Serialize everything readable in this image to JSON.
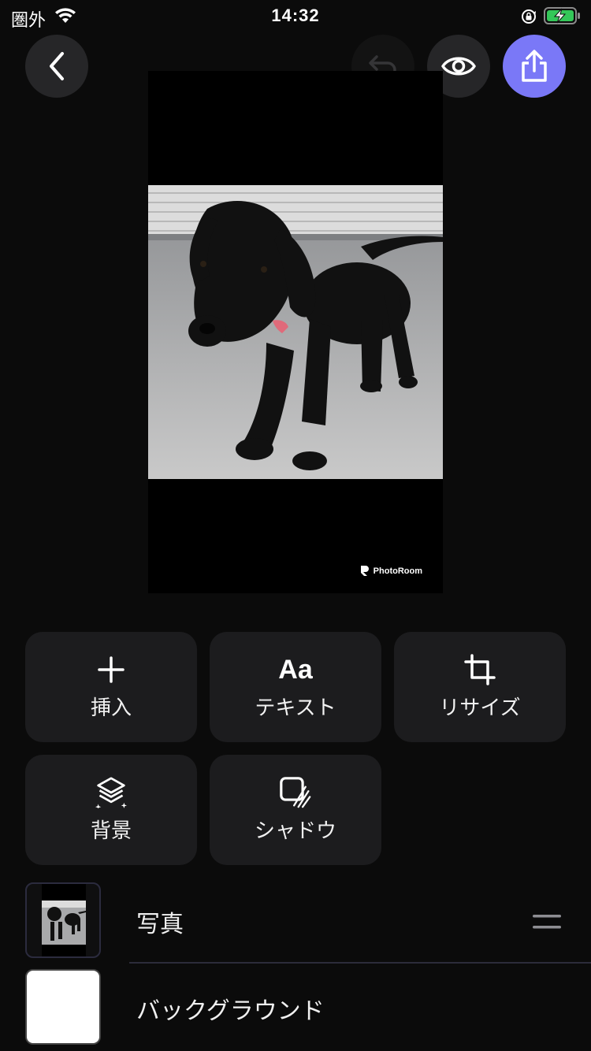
{
  "status_bar": {
    "carrier": "圏外",
    "time": "14:32"
  },
  "toolbar": {
    "back": "back-icon",
    "undo": "undo-icon",
    "preview": "eye-icon",
    "share": "share-icon",
    "share_color": "#7a78f7"
  },
  "canvas": {
    "watermark": "PhotoRoom"
  },
  "actions": [
    {
      "label": "挿入",
      "icon": "plus-icon"
    },
    {
      "label": "テキスト",
      "icon": "text-aa-icon",
      "glyph": "Aa"
    },
    {
      "label": "リサイズ",
      "icon": "crop-icon"
    },
    {
      "label": "背景",
      "icon": "layers-icon"
    },
    {
      "label": "シャドウ",
      "icon": "shadow-icon"
    }
  ],
  "layers": [
    {
      "label": "写真",
      "type": "photo"
    },
    {
      "label": "バックグラウンド",
      "type": "background"
    }
  ]
}
